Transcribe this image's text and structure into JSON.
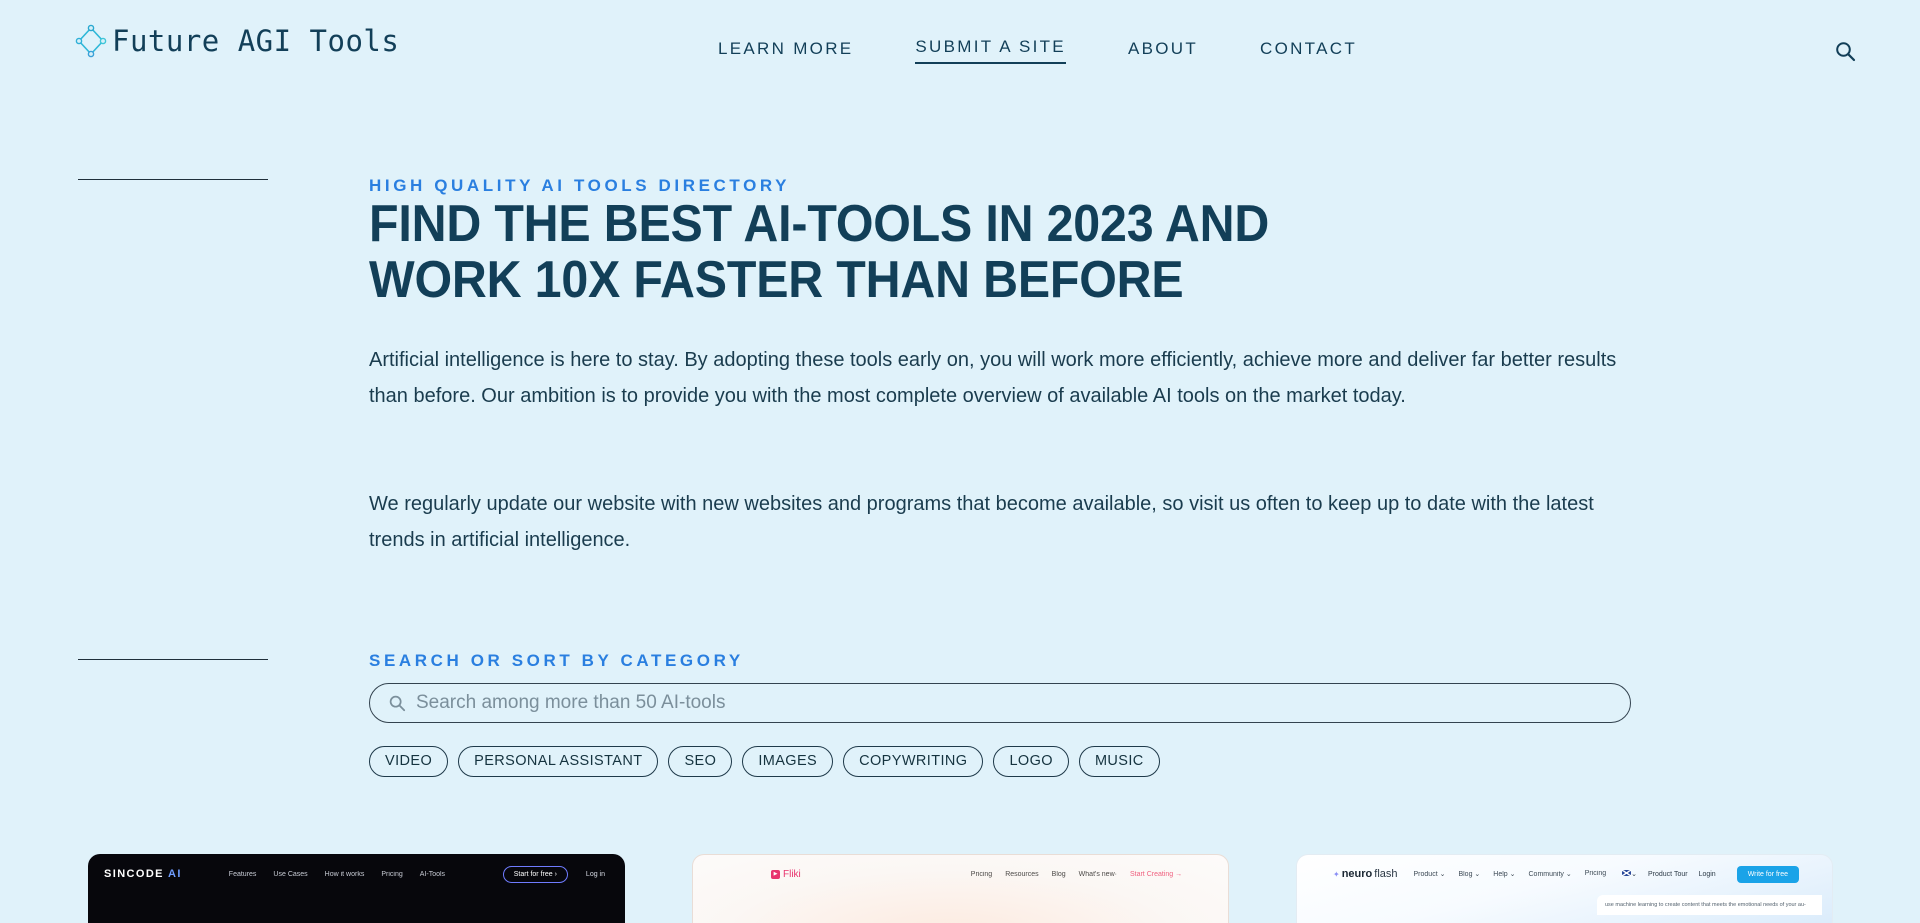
{
  "site": {
    "brand_name": "Future AGI Tools",
    "logo_icon": "diamond-nodes-icon",
    "background_color": "#e0f2fa",
    "accent_color": "#2a7fe0",
    "heading_color": "#123f58"
  },
  "header": {
    "nav": [
      {
        "label": "LEARN MORE",
        "active": false
      },
      {
        "label": "SUBMIT A SITE",
        "active": true
      },
      {
        "label": "ABOUT",
        "active": false
      },
      {
        "label": "CONTACT",
        "active": false
      }
    ],
    "search_icon": "search-icon"
  },
  "hero": {
    "eyebrow": "HIGH QUALITY AI TOOLS DIRECTORY",
    "title": "FIND THE BEST AI-TOOLS IN 2023 AND WORK 10X FASTER THAN BEFORE",
    "paragraph_1": "Artificial intelligence is here to stay. By adopting these tools early on, you will work more efficiently, achieve more and deliver far better results than before. Our ambition is to provide you with the most complete overview of available AI tools on the market today.",
    "paragraph_2": "We regularly update our website with new websites and programs that become available, so visit us often to keep up to date with the latest trends in artificial intelligence."
  },
  "search_section": {
    "eyebrow": "SEARCH OR SORT BY CATEGORY",
    "search_placeholder": "Search among more than 50 AI-tools",
    "search_value": "",
    "search_icon": "search-icon",
    "categories": [
      "VIDEO",
      "PERSONAL ASSISTANT",
      "SEO",
      "IMAGES",
      "COPYWRITING",
      "LOGO",
      "MUSIC"
    ]
  },
  "cards": [
    {
      "id": "sincode",
      "logo_text": "SINCODE",
      "logo_suffix": "AI",
      "links": [
        "Features",
        "Use Cases",
        "How it works",
        "Pricing",
        "AI-Tools"
      ],
      "cta": "Start for free ›",
      "secondary": "Log in"
    },
    {
      "id": "fliki",
      "logo_text": "Fliki",
      "logo_icon": "play-badge-icon",
      "links": [
        "Pricing",
        "Resources",
        "Blog",
        "What's new·"
      ],
      "cta": "Start Creating →"
    },
    {
      "id": "neuroflash",
      "logo_prefix": "neuro",
      "logo_suffix": "flash",
      "links": [
        "Product ⌄",
        "Blog ⌄",
        "Help ⌄",
        "Community ⌄",
        "Pricing"
      ],
      "flag_label": "⌄",
      "product_tour": "Product Tour",
      "login": "Login",
      "cta": "Write for free",
      "body_text": "use machine learning to create content that meets the emotional needs of your au-"
    }
  ]
}
